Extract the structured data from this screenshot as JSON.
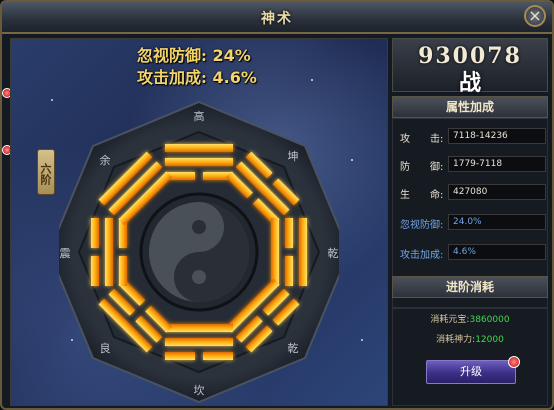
{
  "window": {
    "title": "神术",
    "close_symbol": "×"
  },
  "left": {
    "ignore_defense": {
      "label": "忽视防御:",
      "value": "24%"
    },
    "attack_bonus": {
      "label": "攻击加成:",
      "value": "4.6%"
    },
    "tier_badge": "六阶",
    "trigrams": [
      {
        "name": "高"
      },
      {
        "name": "坤"
      },
      {
        "name": "乾"
      },
      {
        "name": "乾"
      },
      {
        "name": "坎"
      },
      {
        "name": "良"
      },
      {
        "name": "震"
      },
      {
        "name": "余"
      }
    ]
  },
  "power": {
    "value": "930078",
    "label": "战"
  },
  "attributes": {
    "header": "属性加成",
    "rows": [
      {
        "name": "攻　　击:",
        "value": "7118-14236",
        "style": "normal"
      },
      {
        "name": "防　　御:",
        "value": "1779-7118",
        "style": "normal"
      },
      {
        "name": "生　　命:",
        "value": "427080",
        "style": "normal"
      },
      {
        "name": "忽视防御:",
        "value": "24.0%",
        "style": "blue"
      },
      {
        "name": "攻击加成:",
        "value": "4.6%",
        "style": "blue"
      }
    ]
  },
  "cost": {
    "header": "进阶消耗",
    "yuanbao": {
      "label": "消耗元宝:",
      "value": "3860000"
    },
    "shenli": {
      "label": "消耗神力:",
      "value": "12000"
    }
  },
  "upgrade_button": {
    "label": "升级"
  },
  "colors": {
    "accent_gold": "#f2d46a",
    "cost_green": "#43d84f",
    "attr_blue": "#6fa6e8",
    "button_purple": "#4a3c9c"
  },
  "icons": [
    "close-icon",
    "notification-dot-icon",
    "yin-yang-icon"
  ]
}
